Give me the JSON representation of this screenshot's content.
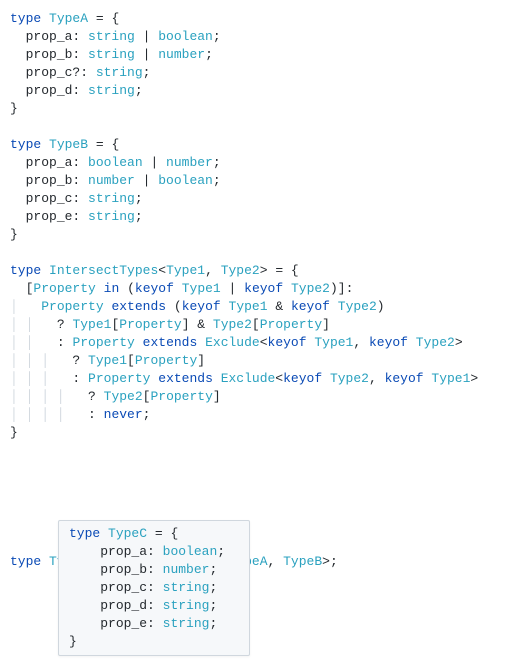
{
  "colors": {
    "keyword": "#0a4ab5",
    "type": "#2aa1bf",
    "plain": "#24292e",
    "guide": "#d0d7de",
    "tooltipBg": "#f6f8fa",
    "tooltipBorder": "#d0d7de"
  },
  "kw": {
    "type": "type",
    "keyof": "keyof",
    "extends": "extends",
    "in": "in",
    "never": "never"
  },
  "ty": {
    "string": "string",
    "boolean": "boolean",
    "number": "number",
    "Type1": "Type1",
    "Type2": "Type2",
    "Property": "Property",
    "Exclude": "Exclude",
    "TypeA": "TypeA",
    "TypeB": "TypeB",
    "TypeC": "TypeC",
    "IntersectTypes": "IntersectTypes"
  },
  "typeA": {
    "name": "TypeA",
    "props": {
      "a": "prop_a",
      "b": "prop_b",
      "c": "prop_c",
      "d": "prop_d"
    }
  },
  "typeB": {
    "name": "TypeB",
    "props": {
      "a": "prop_a",
      "b": "prop_b",
      "c": "prop_c",
      "e": "prop_e"
    }
  },
  "intersect": {
    "name": "IntersectTypes"
  },
  "typeC": {
    "name": "TypeC"
  },
  "tooltip": {
    "name": "TypeC",
    "props": {
      "a": {
        "name": "prop_a",
        "type": "boolean"
      },
      "b": {
        "name": "prop_b",
        "type": "number"
      },
      "c": {
        "name": "prop_c",
        "type": "string"
      },
      "d": {
        "name": "prop_d",
        "type": "string"
      },
      "e": {
        "name": "prop_e",
        "type": "string"
      }
    }
  },
  "sym": {
    "eqbrace": " = {",
    "close": "}",
    "qcolon": "?: ",
    "colon": ": ",
    "semi": ";",
    "pipe": " | ",
    "amp": " & ",
    "lt": "<",
    "gt": ">",
    "comma": ", ",
    "obkt": "[",
    "cbkt": "]",
    "oparen": "(",
    "cparen": ")",
    "q": "? ",
    "col2": ": ",
    "eq": " = "
  },
  "indent": {
    "i1": "  ",
    "g1": "│ ",
    "g2": "│ │ ",
    "g3": "│ │ │ ",
    "g4": "│ │ │ │ "
  }
}
